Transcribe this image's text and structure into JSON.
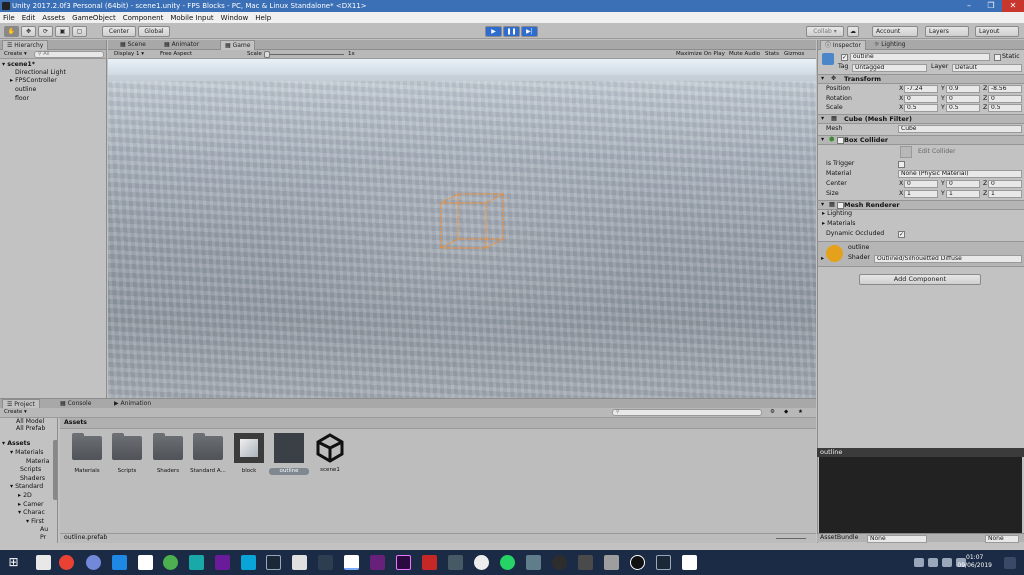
{
  "window": {
    "title": "Unity 2017.2.0f3 Personal (64bit) - scene1.unity - FPS Blocks - PC, Mac & Linux Standalone* <DX11>"
  },
  "menu": [
    "File",
    "Edit",
    "Assets",
    "GameObject",
    "Component",
    "Mobile Input",
    "Window",
    "Help"
  ],
  "toolbar": {
    "pivot": "Center",
    "space": "Global",
    "collab": "Collab ▾",
    "account": "Account",
    "layers": "Layers",
    "layout": "Layout"
  },
  "hierarchy": {
    "tab": "Hierarchy",
    "create": "Create ▾",
    "search": "All",
    "scene": "scene1*",
    "items": [
      "Directional Light",
      "FPSController",
      "outline",
      "floor"
    ]
  },
  "center_tabs": [
    "Scene",
    "Animator",
    "Game"
  ],
  "game_toolbar": {
    "display": "Display 1",
    "aspect": "Free Aspect",
    "scale_label": "Scale",
    "scale_value": "1x",
    "options": [
      "Maximize On Play",
      "Mute Audio",
      "Stats",
      "Gizmos"
    ]
  },
  "inspector": {
    "tabs": [
      "Inspector",
      "Lighting"
    ],
    "object_name": "outline",
    "static_label": "Static",
    "tag_label": "Tag",
    "tag_value": "Untagged",
    "layer_label": "Layer",
    "layer_value": "Default",
    "transform": {
      "title": "Transform",
      "position": {
        "label": "Position",
        "x": "-7.24",
        "y": "0.9",
        "z": "-8.56"
      },
      "rotation": {
        "label": "Rotation",
        "x": "0",
        "y": "0",
        "z": "0"
      },
      "scale": {
        "label": "Scale",
        "x": "0.5",
        "y": "0.5",
        "z": "0.5"
      }
    },
    "mesh_filter": {
      "title": "Cube (Mesh Filter)",
      "mesh_label": "Mesh",
      "mesh_value": "Cube"
    },
    "box_collider": {
      "title": "Box Collider",
      "edit": "Edit Collider",
      "is_trigger": "Is Trigger",
      "material_label": "Material",
      "material_value": "None (Physic Material)",
      "center": {
        "label": "Center",
        "x": "0",
        "y": "0",
        "z": "0"
      },
      "size": {
        "label": "Size",
        "x": "1",
        "y": "1",
        "z": "1"
      }
    },
    "mesh_renderer": {
      "title": "Mesh Renderer",
      "lighting": "Lighting",
      "materials": "Materials",
      "dynamic_occluded": "Dynamic Occluded"
    },
    "material": {
      "name": "outline",
      "shader_label": "Shader",
      "shader_value": "Outlined/Silhouetted Diffuse"
    },
    "add_component": "Add Component",
    "axis": {
      "x": "X",
      "y": "Y",
      "z": "Z"
    }
  },
  "preview": {
    "title": "outline",
    "assetbundle": "AssetBundle",
    "none1": "None",
    "none2": "None"
  },
  "bottom_tabs": [
    "Project",
    "Console",
    "Animation"
  ],
  "project": {
    "create": "Create ▾",
    "favorites": [
      "All Model",
      "All Prefab"
    ],
    "tree": [
      "Assets",
      "Materials",
      "Materia",
      "Scripts",
      "Shaders",
      "Standard",
      "2D",
      "Camer",
      "Charac",
      "First",
      "Au",
      "Pr"
    ],
    "breadcrumb": "Assets",
    "assets": [
      "Materials",
      "Scripts",
      "Shaders",
      "Standard A...",
      "block",
      "outline",
      "scene1"
    ],
    "selected_path": "outline.prefab"
  },
  "clock": {
    "time": "01:07",
    "date": "09/06/2019"
  },
  "colors": {
    "title_bar": "#3b6fb6",
    "play_active": "#2f6ccf",
    "taskbar": "#1b2b45",
    "material_swatch": "#e4a11b",
    "cube_outline": "#ff8a1e"
  }
}
